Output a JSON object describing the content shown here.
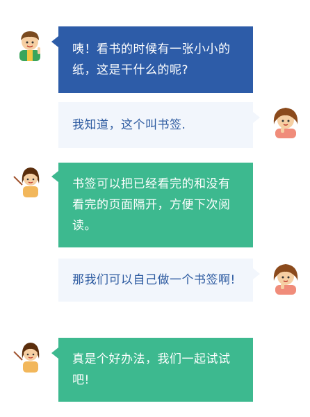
{
  "conversation": {
    "messages": [
      {
        "speaker": "boy",
        "side": "left",
        "style": "blue",
        "text": "咦！看书的时候有一张小小的纸，这是干什么的呢?"
      },
      {
        "speaker": "girl",
        "side": "right",
        "style": "light",
        "text": "我知道，这个叫书签."
      },
      {
        "speaker": "teacher",
        "side": "left",
        "style": "green",
        "text": "书签可以把已经看完的和没有看完的页面隔开，方便下次阅读。"
      },
      {
        "speaker": "girl",
        "side": "right",
        "style": "light",
        "text": "那我们可以自己做一个书签啊!"
      },
      {
        "speaker": "teacher",
        "side": "left",
        "style": "green",
        "text": "真是个好办法，我们一起试试吧!"
      }
    ]
  },
  "colors": {
    "blue_bubble": "#2d5ca8",
    "light_bubble": "#f2f6fc",
    "light_text": "#2c5aa0",
    "green_bubble": "#3db98f"
  },
  "icons": {
    "boy": "boy-avatar-icon",
    "girl": "girl-avatar-icon",
    "teacher": "teacher-avatar-icon"
  }
}
